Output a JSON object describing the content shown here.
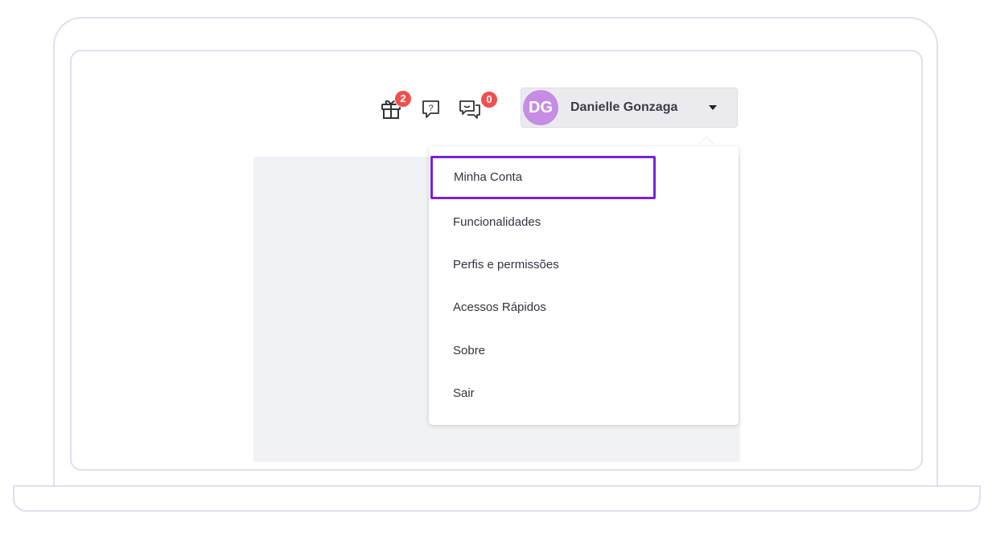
{
  "header": {
    "notifications": {
      "icon": "gift-icon",
      "count": "2"
    },
    "help": {
      "icon": "help-icon"
    },
    "chat": {
      "icon": "chat-icon",
      "count": "0"
    },
    "user": {
      "initials": "DG",
      "name": "Danielle Gonzaga",
      "avatar_color": "#c58de3"
    }
  },
  "user_menu": {
    "items": [
      {
        "label": "Minha Conta",
        "selected": true
      },
      {
        "label": "Funcionalidades"
      },
      {
        "label": "Perfis e permissões"
      },
      {
        "label": "Acessos Rápidos"
      },
      {
        "label": "Sobre"
      },
      {
        "label": "Sair"
      }
    ]
  },
  "colors": {
    "highlight_border": "#7a1fe2",
    "badge": "#f0504f",
    "frame": "#e1def0"
  }
}
